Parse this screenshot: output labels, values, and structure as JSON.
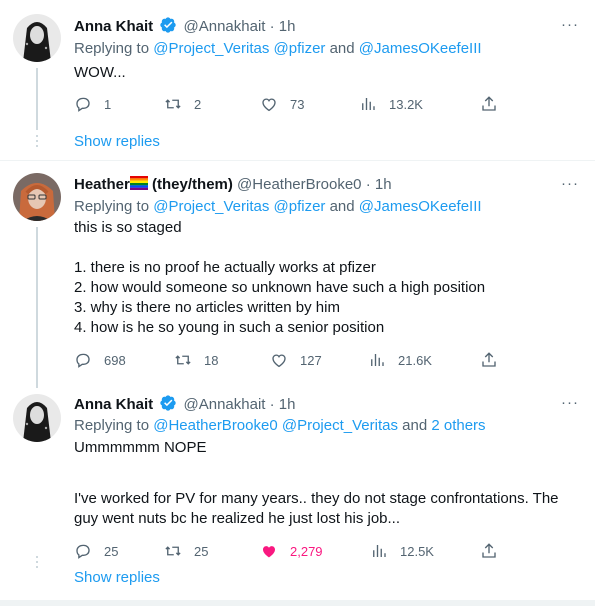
{
  "tweets": [
    {
      "name": "Anna Khait",
      "handle": "@Annakhait",
      "time": "· 1h",
      "replying_prefix": "Replying to ",
      "replying_users": "@Project_Veritas @pfizer",
      "replying_and": " and ",
      "replying_last": "@JamesOKeefeIII",
      "body": [
        "WOW..."
      ],
      "actions": {
        "replies": "1",
        "retweets": "2",
        "likes": "73",
        "views": "13.2K"
      }
    },
    {
      "name": "Heather",
      "name_suffix": " (they/them)",
      "handle": "@HeatherBrooke0",
      "time": "· 1h",
      "replying_prefix": "Replying to ",
      "replying_users": "@Project_Veritas @pfizer",
      "replying_and": " and ",
      "replying_last": "@JamesOKeefeIII",
      "body": [
        "this is so staged",
        "",
        "1. there is no proof he actually works at pfizer",
        "2. how would someone so unknown have such a high position",
        "3. why is there no articles written by him",
        "4. how is he so young in such a senior position"
      ],
      "actions": {
        "replies": "698",
        "retweets": "18",
        "likes": "127",
        "views": "21.6K"
      }
    },
    {
      "name": "Anna Khait",
      "handle": "@Annakhait",
      "time": "· 1h",
      "replying_prefix": "Replying to ",
      "replying_users": "@HeatherBrooke0 @Project_Veritas",
      "replying_and": " and ",
      "replying_last": "2 others",
      "body": [
        "Ummmmmm NOPE",
        "",
        "I've worked for PV for many years.. they do not stage confrontations. The",
        "guy went nuts bc he realized he just lost his job..."
      ],
      "actions": {
        "replies": "25",
        "retweets": "25",
        "likes": "2,279",
        "views": "12.5K"
      }
    }
  ],
  "show_replies_label": "Show replies",
  "more_label": "···",
  "colors": {
    "link": "#1d9bf0",
    "like_active": "#f91880",
    "muted": "#536471",
    "verified": "#1d9bf0"
  }
}
